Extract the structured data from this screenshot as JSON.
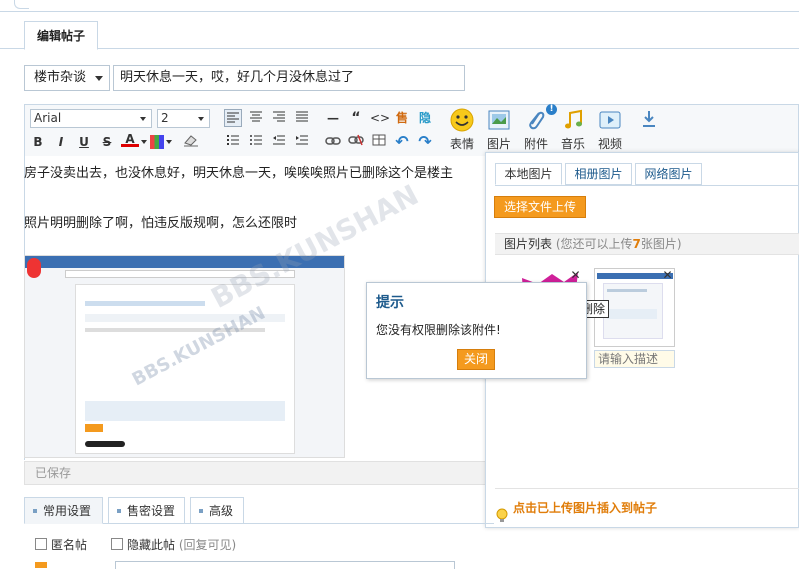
{
  "tab": {
    "label": "编辑帖子"
  },
  "category": {
    "selected": "楼市杂谈"
  },
  "title_input": {
    "value": "明天休息一天，哎，好几个月没休息过了"
  },
  "toolbar": {
    "font_family": "Arial",
    "font_size": "2",
    "bold": "B",
    "italic": "I",
    "underline": "U",
    "strike": "S",
    "font_color": "A",
    "emoticon_label": "表情",
    "image_label": "图片",
    "attachment_label": "附件",
    "attachment_badge": "!",
    "music_label": "音乐",
    "video_label": "视频"
  },
  "editor": {
    "line1": "房子没卖出去，也没休息好，明天休息一天，唉唉唉照片已删除这个是楼主",
    "line2": "照片明明删除了啊，怕违反版规啊，怎么还限时",
    "screenshot_watermark": "BBS.KUNSHAN",
    "status": "已保存"
  },
  "image_panel": {
    "tabs": [
      "本地图片",
      "相册图片",
      "网络图片"
    ],
    "upload_button": "选择文件上传",
    "list_title": "图片列表",
    "list_hint_prefix": "(您还可以上传",
    "list_hint_count": "7",
    "list_hint_suffix": "张图片)",
    "delete_tooltip": "删除",
    "desc_placeholder": "请输入描述",
    "footer_tip": "点击已上传图片插入到帖子"
  },
  "dialog": {
    "title": "提示",
    "message": "您没有权限删除该附件!",
    "close_button": "关闭"
  },
  "settings": {
    "tabs": [
      "常用设置",
      "售密设置",
      "高级"
    ],
    "anonymous_label": "匿名帖",
    "hide_label": "隐藏此帖",
    "hide_hint": "(回复可见)"
  },
  "colors": {
    "accent_orange": "#f49a1e",
    "border_blue": "#c9d8e6",
    "link_blue": "#1d5a8c"
  }
}
